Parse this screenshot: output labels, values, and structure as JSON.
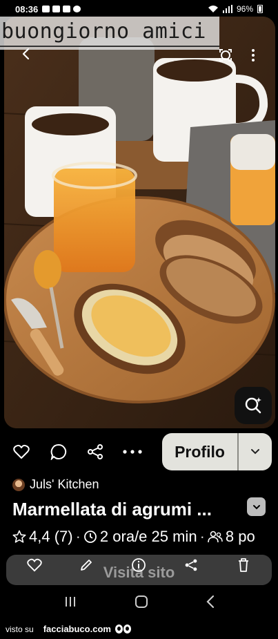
{
  "status": {
    "time": "08:36",
    "battery": "96%"
  },
  "pin": {
    "caption": "buongiorno amici",
    "author": "Juls' Kitchen",
    "title": "Marmellata di agrumi ...",
    "rating": "4,4 (7)",
    "time": "2 ora/e 25 min",
    "servings": "8 po"
  },
  "actions": {
    "profile_label": "Profilo",
    "visit_label": "Visita sito"
  },
  "footer": {
    "prefix": "visto su",
    "site": "facciabuco.com"
  },
  "icons": [
    "back-arrow-icon",
    "lens-icon",
    "more-vertical-icon",
    "visual-search-icon",
    "heart-icon",
    "comment-icon",
    "share-icon",
    "more-horizontal-icon",
    "chevron-down-icon",
    "star-icon",
    "clock-icon",
    "people-icon",
    "pencil-icon",
    "info-icon",
    "trash-icon",
    "recents-icon",
    "home-icon",
    "back-icon"
  ],
  "colors": {
    "profile_bg": "#e3e3dd",
    "visit_bar_bg": "#3b3b3b"
  }
}
